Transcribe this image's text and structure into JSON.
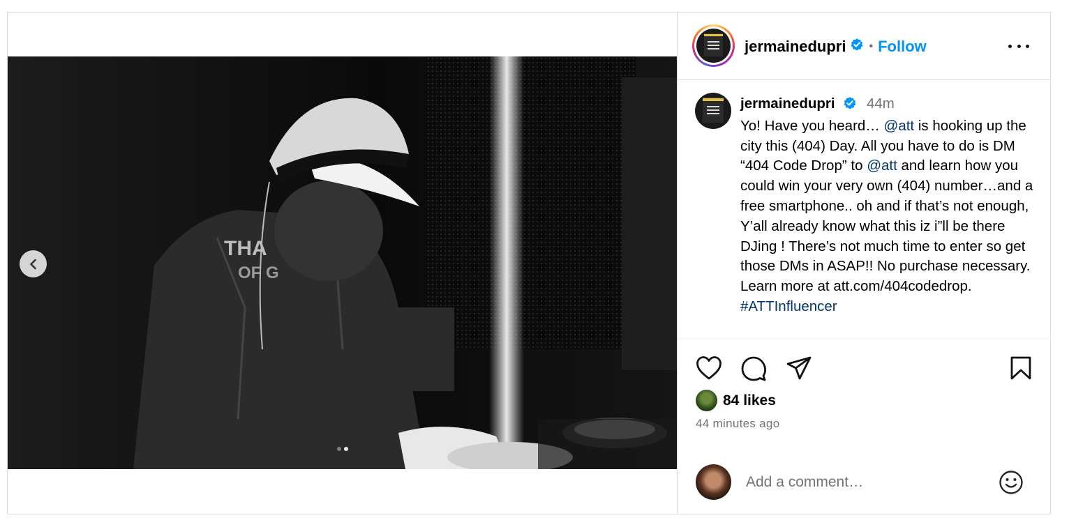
{
  "post": {
    "username": "jermainedupri",
    "follow_label": "Follow",
    "separator": "•",
    "more_icon": "more-horizontal-icon",
    "verified_icon": "verified-badge-icon",
    "carousel": {
      "total": 2,
      "active_index": 1,
      "prev_icon": "chevron-left-icon"
    },
    "caption": {
      "username": "jermainedupri",
      "time": "44m",
      "segments": [
        {
          "type": "text",
          "text": "Yo! Have you heard… "
        },
        {
          "type": "mention",
          "text": "@att"
        },
        {
          "type": "text",
          "text": " is hooking up the city this (404) Day. All you have to do is DM “404 Code Drop” to "
        },
        {
          "type": "mention",
          "text": "@att"
        },
        {
          "type": "text",
          "text": " and learn how you could win your very own (404) number…and a free smartphone.. oh and if that’s not enough, Y’all already know what this iz i”ll be there DJing ! There’s not much time to enter so get those DMs in ASAP!! No purchase necessary. Learn more at att.com/404codedrop. "
        },
        {
          "type": "tag",
          "text": "#ATTInfluencer"
        }
      ]
    },
    "actions": {
      "like_icon": "heart-icon",
      "comment_icon": "comment-icon",
      "share_icon": "send-icon",
      "save_icon": "bookmark-icon"
    },
    "likes": "84 likes",
    "timestamp": "44 minutes ago",
    "comment": {
      "placeholder": "Add a comment…",
      "emoji_icon": "emoji-icon"
    }
  },
  "colors": {
    "link": "#0095f6",
    "mention": "#00376b",
    "muted": "#737373",
    "border": "#dbdbdb",
    "verified": "#0095f6"
  }
}
